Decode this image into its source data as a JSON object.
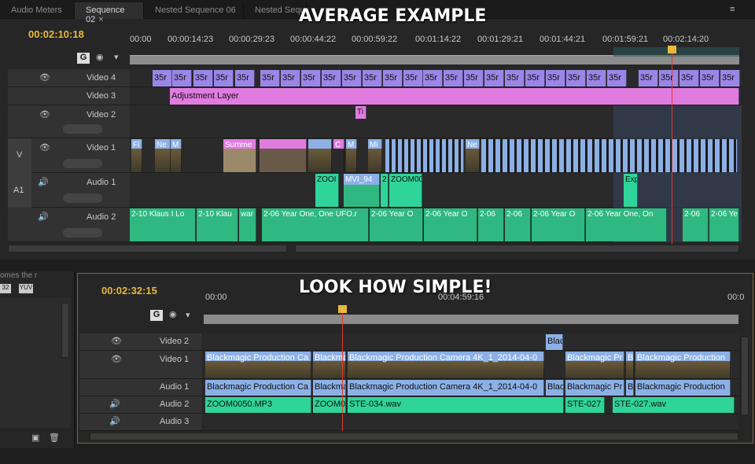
{
  "top": {
    "tabs": [
      "Audio Meters",
      "Sequence 02",
      "Nested Sequence 06",
      "Nested Sequ"
    ],
    "timecode": "00:02:10:18",
    "ruler": [
      "00:00",
      "00:00:14:23",
      "00:00:29:23",
      "00:00:44:22",
      "00:00:59:22",
      "00:01:14:22",
      "00:01:29:21",
      "00:01:44:21",
      "00:01:59:21",
      "00:02:14:20"
    ],
    "heading": "AVERAGE EXAMPLE",
    "tracks": {
      "v4": "Video 4",
      "v3": "Video 3",
      "v2": "Video 2",
      "v1": "Video 1",
      "a1": "Audio 1",
      "a2": "Audio 2"
    },
    "src_v": "V",
    "src_a": "A1",
    "clips": {
      "v4": "35r",
      "adj": "Adjustment Layer",
      "v2a": "Ti",
      "v1a": "Fi",
      "v1b": "Ne",
      "v1c": "M",
      "v1d": "Summe",
      "v1e": "C",
      "v1f": "Ne",
      "v1g": "M",
      "v1h": "Mi",
      "v1i": "Ne",
      "a1a": "ZOOI",
      "a1b": "MVI_94",
      "a1c": "ZOOM00",
      "a1d": "2",
      "a1e": "Exp",
      "a2a": "2-10 Klaus I Lo",
      "a2b": "2-10 Klau",
      "a2c": "war",
      "a2d": "2-06 Year One, One UFO.r",
      "a2e": "2-06 Year O",
      "a2f": "2-06 Year O",
      "a2g": "2-06",
      "a2h": "2-06",
      "a2i": "2-06 Year O",
      "a2j": "2-06 Year One, On",
      "a2k": "2-06",
      "a2l": "2-06 Ye"
    }
  },
  "bottom": {
    "heading": "LOOK HOW SIMPLE!",
    "timecode": "00:02:32:15",
    "ruler": [
      "00:00",
      "00:04:59:16",
      "00:0"
    ],
    "side_label": "omes the r",
    "side_badges": [
      "32",
      "YUV"
    ],
    "tracks": {
      "v2": "Video 2",
      "v1": "Video 1",
      "a1": "Audio 1",
      "a2": "Audio 2",
      "a3": "Audio 3"
    },
    "clips": {
      "v2a": "Blac",
      "v1a": "Blackmagic Production Ca",
      "v1b": "Blackma",
      "v1c": "Blackmagic Production Camera 4K_1_2014-04-0",
      "v1d": "Blackmagic Pr",
      "v1e": "B",
      "v1f": "Blackmagic Production",
      "a1a": "Blackmagic Production Ca",
      "a1b": "Blackma",
      "a1c": "Blackmagic Production Camera 4K_1_2014-04-0",
      "a1d": "Blac",
      "a1e": "Blackmagic Pr",
      "a1f": "B",
      "a1g": "Blackmagic Production",
      "a2a": "ZOOM0050.MP3",
      "a2b": "ZOOM00",
      "a2c": "STE-034.wav",
      "a2d": "STE-027",
      "a2e": "STE-027.wav"
    }
  }
}
